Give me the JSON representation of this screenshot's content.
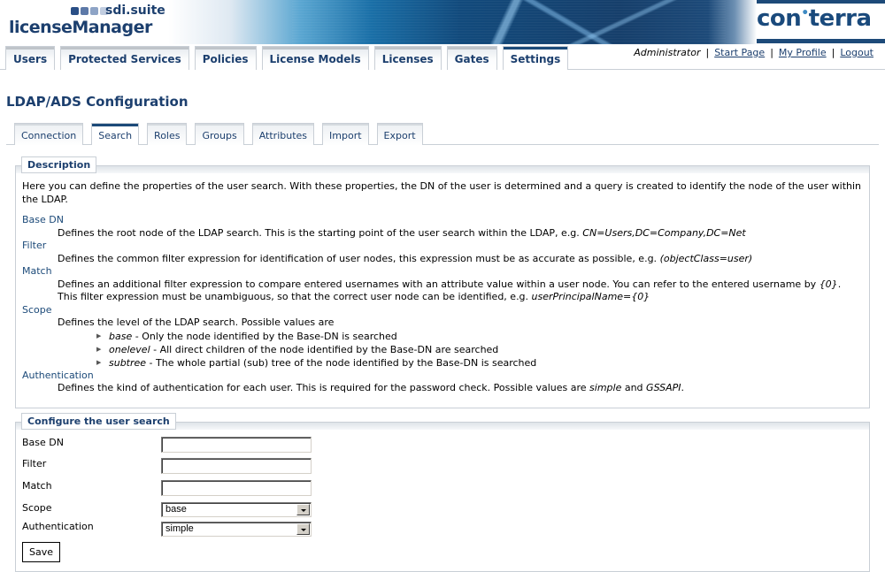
{
  "header": {
    "suite_name": "sdi.suite",
    "product_name": "licenseManager",
    "company_logo_left": "con",
    "company_logo_right": "terra",
    "logo_squares_colors": [
      "#2a4f86",
      "#5d79a8",
      "#8ea4c6",
      "#c1cde0"
    ]
  },
  "main_nav": {
    "tabs": [
      {
        "label": "Users"
      },
      {
        "label": "Protected Services"
      },
      {
        "label": "Policies"
      },
      {
        "label": "License Models"
      },
      {
        "label": "Licenses"
      },
      {
        "label": "Gates"
      },
      {
        "label": "Settings",
        "active": true
      }
    ]
  },
  "user_links": {
    "user": "Administrator",
    "separator": "|",
    "start_page": "Start Page",
    "my_profile": "My Profile",
    "logout": "Logout"
  },
  "page": {
    "title": "LDAP/ADS Configuration"
  },
  "sub_nav": {
    "tabs": [
      {
        "label": "Connection"
      },
      {
        "label": "Search",
        "active": true
      },
      {
        "label": "Roles"
      },
      {
        "label": "Groups"
      },
      {
        "label": "Attributes"
      },
      {
        "label": "Import"
      },
      {
        "label": "Export"
      }
    ]
  },
  "description": {
    "legend": "Description",
    "intro": "Here you can define the properties of the user search. With these properties, the DN of the user is determined and a query is created to identify the node of the user within the LDAP.",
    "base_dn": {
      "term": "Base DN",
      "text": "Defines the root node of the LDAP search. This is the starting point of the user search within the LDAP, e.g. ",
      "example": "CN=Users,DC=Company,DC=Net"
    },
    "filter": {
      "term": "Filter",
      "text": "Defines the common filter expression for identification of user nodes, this expression must be as accurate as possible, e.g. ",
      "example": "(objectClass=user)"
    },
    "match": {
      "term": "Match",
      "text1": "Defines an additional filter expression to compare entered usernames with an attribute value within a user node. You can refer to the entered username by ",
      "placeholder": "{0}",
      "text2": ". This filter expression must be unambiguous, so that the correct user node can be identified, e.g. ",
      "example": "userPrincipalName={0}"
    },
    "scope": {
      "term": "Scope",
      "text": "Defines the level of the LDAP search. Possible values are",
      "values": [
        {
          "name": "base",
          "text": " - Only the node identified by the Base-DN is searched"
        },
        {
          "name": "onelevel",
          "text": " - All direct children of the node identified by the Base-DN are searched"
        },
        {
          "name": "subtree",
          "text": " - The whole partial (sub) tree of the node identified by the Base-DN is searched"
        }
      ]
    },
    "authentication": {
      "term": "Authentication",
      "text": "Defines the kind of authentication for each user. This is required for the password check. Possible values are ",
      "value1": "simple",
      "and": " and ",
      "value2": "GSSAPI",
      "end": "."
    }
  },
  "config": {
    "legend": "Configure the user search",
    "fields": {
      "base_dn": {
        "label": "Base DN",
        "value": ""
      },
      "filter": {
        "label": "Filter",
        "value": ""
      },
      "match": {
        "label": "Match",
        "value": ""
      },
      "scope": {
        "label": "Scope",
        "selected": "base"
      },
      "authentication": {
        "label": "Authentication",
        "selected": "simple"
      }
    },
    "save_label": "Save"
  }
}
